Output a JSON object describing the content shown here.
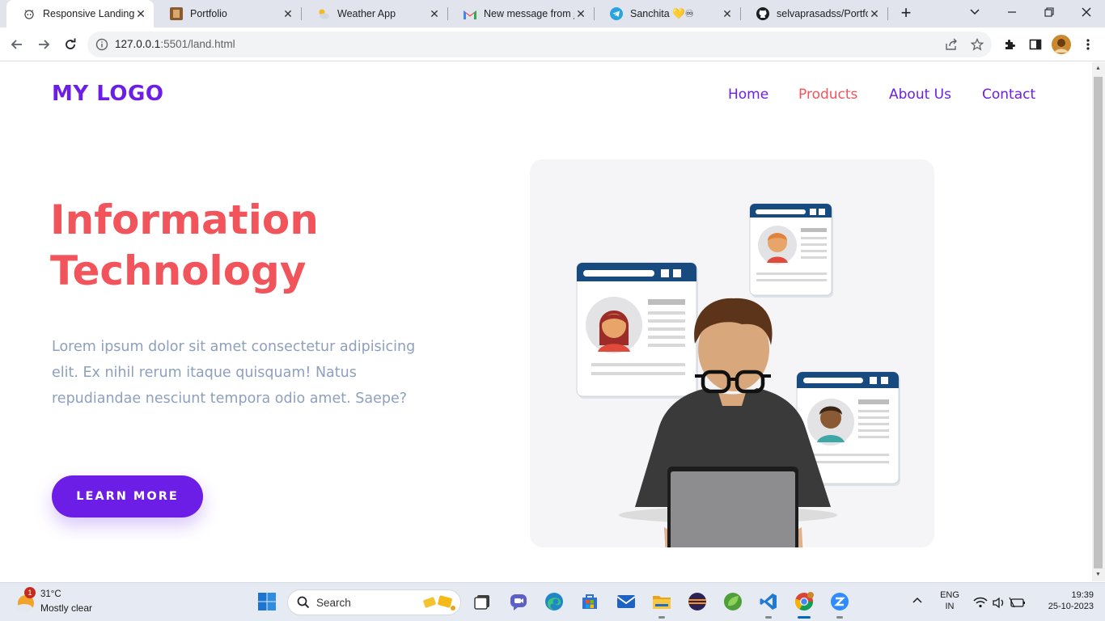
{
  "browser": {
    "tabs": [
      {
        "title": "Responsive Landing P",
        "active": true
      },
      {
        "title": "Portfolio"
      },
      {
        "title": "Weather App"
      },
      {
        "title": "New message from je"
      },
      {
        "title": "Sanchita 💛♾"
      },
      {
        "title": "selvaprasadss/Portfol"
      }
    ],
    "url_host": "127.0.0.1",
    "url_rest": ":5501/land.html"
  },
  "page": {
    "logo": "MY LOGO",
    "nav": [
      "Home",
      "Products",
      "About Us",
      "Contact"
    ],
    "active_nav": "Products",
    "headline_line1": "Information",
    "headline_line2": "Technology",
    "paragraph": "Lorem ipsum dolor sit amet consectetur adipisicing elit. Ex nihil rerum itaque quisquam! Natus repudiandae nesciunt tempora odio amet. Saepe?",
    "cta_label": "LEARN MORE",
    "colors": {
      "accent": "#6d1ee6",
      "highlight": "#f2545b",
      "muted_text": "#8ea0bd"
    }
  },
  "taskbar": {
    "weather_temp": "31°C",
    "weather_condition": "Mostly clear",
    "weather_badge": "1",
    "search_label": "Search",
    "language_top": "ENG",
    "language_bottom": "IN",
    "time": "19:39",
    "date": "25-10-2023"
  }
}
